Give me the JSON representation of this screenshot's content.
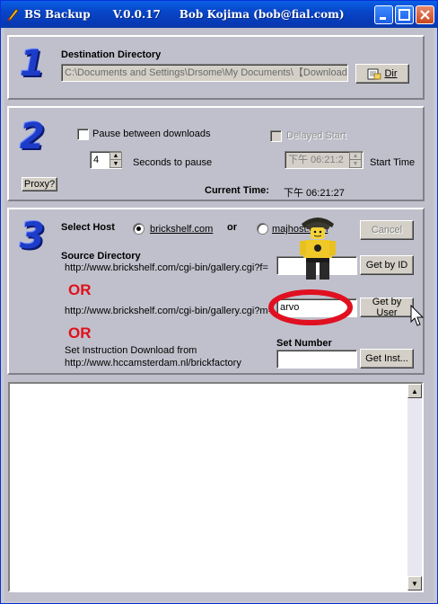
{
  "window": {
    "title": "BS Backup      V.0.0.17     Bob Kojima (bob@fial.com)"
  },
  "section1": {
    "number": "1",
    "destination_label": "Destination Directory",
    "destination_value": "C:\\Documents and Settings\\Drsome\\My Documents\\【Download",
    "dir_button": "Dir"
  },
  "section2": {
    "number": "2",
    "pause_label": "Pause between downloads",
    "pause_checked": false,
    "seconds_value": "4",
    "seconds_label": "Seconds to pause",
    "delayed_start_label": "Delayed Start",
    "delayed_time_value": "下午 06:21:2",
    "start_time_label": "Start Time",
    "proxy_button": "Proxy?",
    "current_time_label": "Current Time:",
    "current_time_value": "下午 06:21:27"
  },
  "section3": {
    "number": "3",
    "select_host_label": "Select Host",
    "host_option_1": "brickshelf.com",
    "host_or": "or",
    "host_option_2": "majhost.com",
    "selected_host": "brickshelf.com",
    "cancel_button": "Cancel",
    "source_directory_label": "Source Directory",
    "url_by_id": "http://www.brickshelf.com/cgi-bin/gallery.cgi?f=",
    "id_value": "",
    "get_by_id_button": "Get by ID",
    "or_1": "OR",
    "url_by_user": "http://www.brickshelf.com/cgi-bin/gallery.cgi?m=",
    "user_value": "arvo",
    "get_by_user_button": "Get by User",
    "or_2": "OR",
    "instruction_label": "Set Instruction Download from",
    "instruction_url": "http://www.hccamsterdam.nl/brickfactory",
    "set_number_label": "Set Number",
    "set_number_value": "",
    "get_inst_button": "Get Inst..."
  },
  "log": {
    "content": ""
  },
  "colors": {
    "titlebar": "#0846c8",
    "panel": "#c0c0cc",
    "accent_number": "#1d3cc8",
    "or_red": "#e0101a",
    "highlight_circle": "#e01020"
  }
}
